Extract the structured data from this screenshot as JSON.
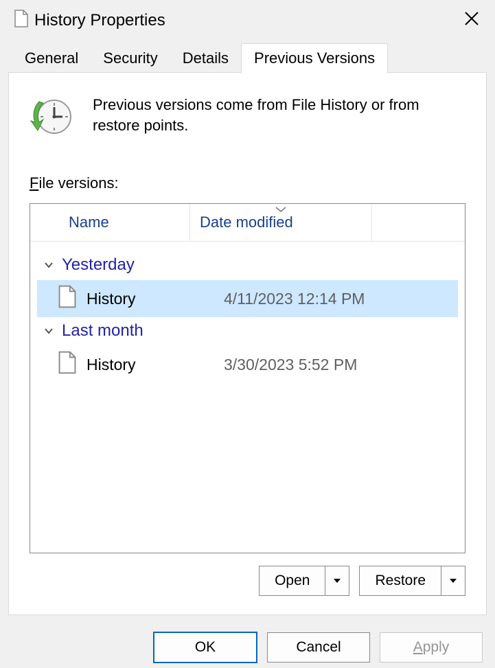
{
  "window": {
    "title": "History Properties"
  },
  "tabs": {
    "general": "General",
    "security": "Security",
    "details": "Details",
    "previous_versions": "Previous Versions",
    "active": "previous_versions"
  },
  "intro": "Previous versions come from File History or from restore points.",
  "versions_label_prefix": "F",
  "versions_label_rest": "ile versions:",
  "columns": {
    "name": "Name",
    "date": "Date modified"
  },
  "groups": [
    {
      "title": "Yesterday",
      "items": [
        {
          "name": "History",
          "date": "4/11/2023 12:14 PM",
          "selected": true
        }
      ]
    },
    {
      "title": "Last month",
      "items": [
        {
          "name": "History",
          "date": "3/30/2023 5:52 PM",
          "selected": false
        }
      ]
    }
  ],
  "actions": {
    "open": "Open",
    "restore": "Restore"
  },
  "buttons": {
    "ok": "OK",
    "cancel": "Cancel",
    "apply_prefix": "A",
    "apply_rest": "pply"
  }
}
